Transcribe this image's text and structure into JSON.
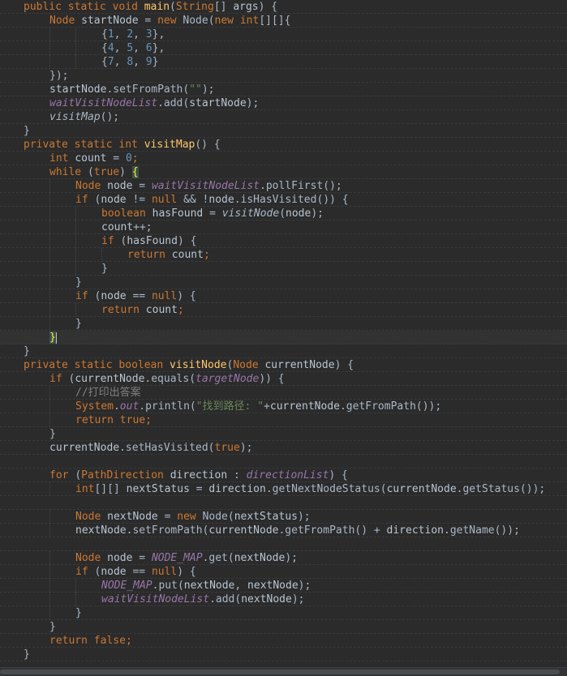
{
  "editor": {
    "theme_colors": {
      "background": "#2b2b2b",
      "keyword": "#cc7832",
      "string": "#6a8759",
      "number": "#6897bb",
      "method_decl": "#ffc66d",
      "field": "#9876aa",
      "comment": "#808080",
      "text": "#a9b7c6"
    },
    "current_line": 25,
    "lines": [
      [
        [
          "k",
          "public "
        ],
        [
          "k",
          "static "
        ],
        [
          "k",
          "void "
        ],
        [
          "m",
          "main"
        ],
        [
          "p",
          "("
        ],
        [
          "k",
          "String"
        ],
        [
          "p",
          "[] "
        ],
        [
          "local",
          "args"
        ],
        [
          "p",
          ") {"
        ]
      ],
      [
        [
          "i",
          1
        ],
        [
          "k",
          "Node "
        ],
        [
          "local",
          "startNode"
        ],
        [
          "p",
          " = "
        ],
        [
          "k",
          "new "
        ],
        [
          "id",
          "Node"
        ],
        [
          "p",
          "("
        ],
        [
          "k",
          "new "
        ],
        [
          "k",
          "int"
        ],
        [
          "p",
          "[][]{"
        ]
      ],
      [
        [
          "i",
          3
        ],
        [
          "p",
          "{"
        ],
        [
          "n",
          "1"
        ],
        [
          "p",
          ", "
        ],
        [
          "n",
          "2"
        ],
        [
          "p",
          ", "
        ],
        [
          "n",
          "3"
        ],
        [
          "p",
          "},"
        ]
      ],
      [
        [
          "i",
          3
        ],
        [
          "p",
          "{"
        ],
        [
          "n",
          "4"
        ],
        [
          "p",
          ", "
        ],
        [
          "n",
          "5"
        ],
        [
          "p",
          ", "
        ],
        [
          "n",
          "6"
        ],
        [
          "p",
          "},"
        ]
      ],
      [
        [
          "i",
          3
        ],
        [
          "p",
          "{"
        ],
        [
          "n",
          "7"
        ],
        [
          "p",
          ", "
        ],
        [
          "n",
          "8"
        ],
        [
          "p",
          ", "
        ],
        [
          "n",
          "9"
        ],
        [
          "p",
          "}"
        ]
      ],
      [
        [
          "i",
          1
        ],
        [
          "p",
          "});"
        ]
      ],
      [
        [
          "i",
          1
        ],
        [
          "local",
          "startNode"
        ],
        [
          "p",
          "."
        ],
        [
          "id",
          "setFromPath"
        ],
        [
          "p",
          "("
        ],
        [
          "s",
          "\"\""
        ],
        [
          "p",
          ");"
        ]
      ],
      [
        [
          "i",
          1
        ],
        [
          "f",
          "waitVisitNodeList"
        ],
        [
          "p",
          "."
        ],
        [
          "id",
          "add"
        ],
        [
          "p",
          "("
        ],
        [
          "local",
          "startNode"
        ],
        [
          "p",
          ");"
        ]
      ],
      [
        [
          "i",
          1
        ],
        [
          "mc",
          "visitMap"
        ],
        [
          "p",
          "();"
        ]
      ],
      [
        [
          "p",
          "}"
        ]
      ],
      [
        [
          "k",
          "private "
        ],
        [
          "k",
          "static "
        ],
        [
          "k",
          "int "
        ],
        [
          "m",
          "visitMap"
        ],
        [
          "p",
          "() {"
        ]
      ],
      [
        [
          "i",
          1
        ],
        [
          "k",
          "int "
        ],
        [
          "local",
          "count"
        ],
        [
          "p",
          " = "
        ],
        [
          "n",
          "0"
        ],
        [
          "k",
          ";"
        ]
      ],
      [
        [
          "i",
          1
        ],
        [
          "k",
          "while "
        ],
        [
          "p",
          "("
        ],
        [
          "k",
          "true"
        ],
        [
          "p",
          ") "
        ],
        [
          "bh",
          "{"
        ]
      ],
      [
        [
          "i",
          2
        ],
        [
          "k",
          "Node "
        ],
        [
          "local",
          "node"
        ],
        [
          "p",
          " = "
        ],
        [
          "f",
          "waitVisitNodeList"
        ],
        [
          "p",
          "."
        ],
        [
          "id",
          "pollFirst"
        ],
        [
          "p",
          "();"
        ]
      ],
      [
        [
          "i",
          2
        ],
        [
          "k",
          "if "
        ],
        [
          "p",
          "("
        ],
        [
          "local",
          "node"
        ],
        [
          "p",
          " != "
        ],
        [
          "k",
          "null "
        ],
        [
          "p",
          "&& !"
        ],
        [
          "local",
          "node"
        ],
        [
          "p",
          "."
        ],
        [
          "id",
          "isHasVisited"
        ],
        [
          "p",
          "()) {"
        ]
      ],
      [
        [
          "i",
          3
        ],
        [
          "k",
          "boolean "
        ],
        [
          "local",
          "hasFound"
        ],
        [
          "p",
          " = "
        ],
        [
          "mc",
          "visitNode"
        ],
        [
          "p",
          "("
        ],
        [
          "local",
          "node"
        ],
        [
          "p",
          ");"
        ]
      ],
      [
        [
          "i",
          3
        ],
        [
          "local",
          "count"
        ],
        [
          "p",
          "++;"
        ]
      ],
      [
        [
          "i",
          3
        ],
        [
          "k",
          "if "
        ],
        [
          "p",
          "("
        ],
        [
          "local",
          "hasFound"
        ],
        [
          "p",
          ") {"
        ]
      ],
      [
        [
          "i",
          4
        ],
        [
          "k",
          "return "
        ],
        [
          "local",
          "count"
        ],
        [
          "k",
          ";"
        ]
      ],
      [
        [
          "i",
          3
        ],
        [
          "p",
          "}"
        ]
      ],
      [
        [
          "i",
          2
        ],
        [
          "p",
          "}"
        ]
      ],
      [
        [
          "i",
          2
        ],
        [
          "k",
          "if "
        ],
        [
          "p",
          "("
        ],
        [
          "local",
          "node"
        ],
        [
          "p",
          " == "
        ],
        [
          "k",
          "null"
        ],
        [
          "p",
          ") {"
        ]
      ],
      [
        [
          "i",
          3
        ],
        [
          "k",
          "return "
        ],
        [
          "local",
          "count"
        ],
        [
          "k",
          ";"
        ]
      ],
      [
        [
          "i",
          2
        ],
        [
          "p",
          "}"
        ]
      ],
      [
        [
          "i",
          1
        ],
        [
          "bh",
          "}"
        ],
        [
          "caret",
          ""
        ]
      ],
      [
        [
          "p",
          "}"
        ]
      ],
      [
        [
          "k",
          "private "
        ],
        [
          "k",
          "static "
        ],
        [
          "k",
          "boolean "
        ],
        [
          "m",
          "visitNode"
        ],
        [
          "p",
          "("
        ],
        [
          "k",
          "Node "
        ],
        [
          "local",
          "currentNode"
        ],
        [
          "p",
          ") {"
        ]
      ],
      [
        [
          "i",
          1
        ],
        [
          "k",
          "if "
        ],
        [
          "p",
          "("
        ],
        [
          "local",
          "currentNode"
        ],
        [
          "p",
          "."
        ],
        [
          "id",
          "equals"
        ],
        [
          "p",
          "("
        ],
        [
          "f",
          "targetNode"
        ],
        [
          "p",
          ")) {"
        ]
      ],
      [
        [
          "i",
          2
        ],
        [
          "c",
          "//打印出答案"
        ]
      ],
      [
        [
          "i",
          2
        ],
        [
          "k",
          "System"
        ],
        [
          "p",
          "."
        ],
        [
          "f",
          "out"
        ],
        [
          "p",
          "."
        ],
        [
          "id",
          "println"
        ],
        [
          "p",
          "("
        ],
        [
          "s",
          "\"找到路径: \""
        ],
        [
          "p",
          "+"
        ],
        [
          "local",
          "currentNode"
        ],
        [
          "p",
          "."
        ],
        [
          "id",
          "getFromPath"
        ],
        [
          "p",
          "());"
        ]
      ],
      [
        [
          "i",
          2
        ],
        [
          "k",
          "return "
        ],
        [
          "k",
          "true"
        ],
        [
          "k",
          ";"
        ]
      ],
      [
        [
          "i",
          1
        ],
        [
          "p",
          "}"
        ]
      ],
      [
        [
          "i",
          1
        ],
        [
          "local",
          "currentNode"
        ],
        [
          "p",
          "."
        ],
        [
          "id",
          "setHasVisited"
        ],
        [
          "p",
          "("
        ],
        [
          "k",
          "true"
        ],
        [
          "p",
          ");"
        ]
      ],
      [],
      [
        [
          "i",
          1
        ],
        [
          "k",
          "for "
        ],
        [
          "p",
          "("
        ],
        [
          "k",
          "PathDirection "
        ],
        [
          "local",
          "direction"
        ],
        [
          "p",
          " : "
        ],
        [
          "f",
          "directionList"
        ],
        [
          "p",
          ") {"
        ]
      ],
      [
        [
          "i",
          2
        ],
        [
          "k",
          "int"
        ],
        [
          "p",
          "[][] "
        ],
        [
          "local",
          "nextStatus"
        ],
        [
          "p",
          " = "
        ],
        [
          "local",
          "direction"
        ],
        [
          "p",
          "."
        ],
        [
          "id",
          "getNextNodeStatus"
        ],
        [
          "p",
          "("
        ],
        [
          "local",
          "currentNode"
        ],
        [
          "p",
          "."
        ],
        [
          "id",
          "getStatus"
        ],
        [
          "p",
          "());"
        ]
      ],
      [],
      [
        [
          "i",
          2
        ],
        [
          "k",
          "Node "
        ],
        [
          "local",
          "nextNode"
        ],
        [
          "p",
          " = "
        ],
        [
          "k",
          "new "
        ],
        [
          "id",
          "Node"
        ],
        [
          "p",
          "("
        ],
        [
          "local",
          "nextStatus"
        ],
        [
          "p",
          ");"
        ]
      ],
      [
        [
          "i",
          2
        ],
        [
          "local",
          "nextNode"
        ],
        [
          "p",
          "."
        ],
        [
          "id",
          "setFromPath"
        ],
        [
          "p",
          "("
        ],
        [
          "local",
          "currentNode"
        ],
        [
          "p",
          "."
        ],
        [
          "id",
          "getFromPath"
        ],
        [
          "p",
          "() + "
        ],
        [
          "local",
          "direction"
        ],
        [
          "p",
          "."
        ],
        [
          "id",
          "getName"
        ],
        [
          "p",
          "());"
        ]
      ],
      [],
      [
        [
          "i",
          2
        ],
        [
          "k",
          "Node "
        ],
        [
          "local",
          "node"
        ],
        [
          "p",
          " = "
        ],
        [
          "f",
          "NODE_MAP"
        ],
        [
          "p",
          "."
        ],
        [
          "id",
          "get"
        ],
        [
          "p",
          "("
        ],
        [
          "local",
          "nextNode"
        ],
        [
          "p",
          ");"
        ]
      ],
      [
        [
          "i",
          2
        ],
        [
          "k",
          "if "
        ],
        [
          "p",
          "("
        ],
        [
          "local",
          "node"
        ],
        [
          "p",
          " == "
        ],
        [
          "k",
          "null"
        ],
        [
          "p",
          ") {"
        ]
      ],
      [
        [
          "i",
          3
        ],
        [
          "f",
          "NODE_MAP"
        ],
        [
          "p",
          "."
        ],
        [
          "id",
          "put"
        ],
        [
          "p",
          "("
        ],
        [
          "local",
          "nextNode"
        ],
        [
          "p",
          ", "
        ],
        [
          "local",
          "nextNode"
        ],
        [
          "p",
          ");"
        ]
      ],
      [
        [
          "i",
          3
        ],
        [
          "f",
          "waitVisitNodeList"
        ],
        [
          "p",
          "."
        ],
        [
          "id",
          "add"
        ],
        [
          "p",
          "("
        ],
        [
          "local",
          "nextNode"
        ],
        [
          "p",
          ");"
        ]
      ],
      [
        [
          "i",
          2
        ],
        [
          "p",
          "}"
        ]
      ],
      [
        [
          "i",
          1
        ],
        [
          "p",
          "}"
        ]
      ],
      [
        [
          "i",
          1
        ],
        [
          "k",
          "return "
        ],
        [
          "k",
          "false"
        ],
        [
          "k",
          ";"
        ]
      ],
      [
        [
          "p",
          "}"
        ]
      ]
    ]
  }
}
